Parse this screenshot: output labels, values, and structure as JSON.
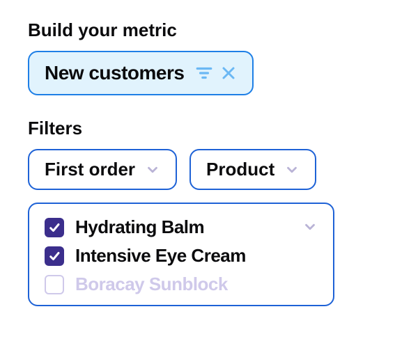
{
  "metric": {
    "section_label": "Build your metric",
    "selected": "New customers"
  },
  "filters": {
    "section_label": "Filters",
    "chips": [
      {
        "label": "First order"
      },
      {
        "label": "Product"
      }
    ],
    "options": [
      {
        "label": "Hydrating Balm",
        "checked": true
      },
      {
        "label": "Intensive Eye Cream",
        "checked": true
      },
      {
        "label": "Boracay Sunblock",
        "checked": false
      }
    ]
  },
  "colors": {
    "accent_blue": "#1e7fe6",
    "pill_bg": "#e1f3fd",
    "checkbox_fill": "#3b2e8c",
    "muted": "#cfc9ea"
  }
}
